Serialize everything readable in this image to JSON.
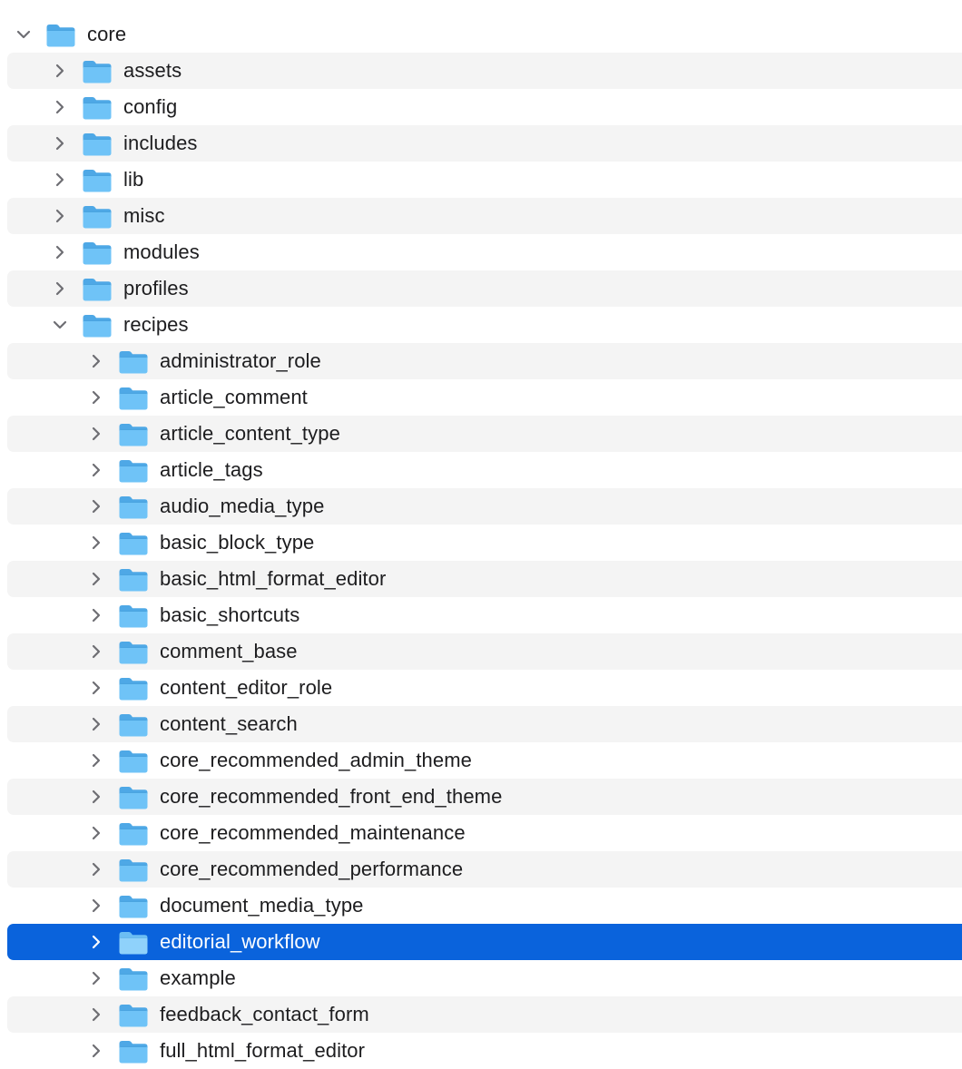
{
  "colors": {
    "selection": "#0a63dc",
    "stripe": "#f4f4f4",
    "folder_body": "#6fc3f7",
    "folder_tab": "#4ea8e6",
    "text": "#1d1d1f"
  },
  "tree": {
    "items": [
      {
        "label": "core",
        "depth": 0,
        "expanded": true,
        "icon": "folder-icon"
      },
      {
        "label": "assets",
        "depth": 1,
        "expanded": false,
        "icon": "folder-icon"
      },
      {
        "label": "config",
        "depth": 1,
        "expanded": false,
        "icon": "folder-icon"
      },
      {
        "label": "includes",
        "depth": 1,
        "expanded": false,
        "icon": "folder-icon"
      },
      {
        "label": "lib",
        "depth": 1,
        "expanded": false,
        "icon": "folder-icon"
      },
      {
        "label": "misc",
        "depth": 1,
        "expanded": false,
        "icon": "folder-icon"
      },
      {
        "label": "modules",
        "depth": 1,
        "expanded": false,
        "icon": "folder-icon"
      },
      {
        "label": "profiles",
        "depth": 1,
        "expanded": false,
        "icon": "folder-icon"
      },
      {
        "label": "recipes",
        "depth": 1,
        "expanded": true,
        "icon": "folder-icon"
      },
      {
        "label": "administrator_role",
        "depth": 2,
        "expanded": false,
        "icon": "folder-icon"
      },
      {
        "label": "article_comment",
        "depth": 2,
        "expanded": false,
        "icon": "folder-icon"
      },
      {
        "label": "article_content_type",
        "depth": 2,
        "expanded": false,
        "icon": "folder-icon"
      },
      {
        "label": "article_tags",
        "depth": 2,
        "expanded": false,
        "icon": "folder-icon"
      },
      {
        "label": "audio_media_type",
        "depth": 2,
        "expanded": false,
        "icon": "folder-icon"
      },
      {
        "label": "basic_block_type",
        "depth": 2,
        "expanded": false,
        "icon": "folder-icon"
      },
      {
        "label": "basic_html_format_editor",
        "depth": 2,
        "expanded": false,
        "icon": "folder-icon"
      },
      {
        "label": "basic_shortcuts",
        "depth": 2,
        "expanded": false,
        "icon": "folder-icon"
      },
      {
        "label": "comment_base",
        "depth": 2,
        "expanded": false,
        "icon": "folder-icon"
      },
      {
        "label": "content_editor_role",
        "depth": 2,
        "expanded": false,
        "icon": "folder-icon"
      },
      {
        "label": "content_search",
        "depth": 2,
        "expanded": false,
        "icon": "folder-icon"
      },
      {
        "label": "core_recommended_admin_theme",
        "depth": 2,
        "expanded": false,
        "icon": "folder-icon"
      },
      {
        "label": "core_recommended_front_end_theme",
        "depth": 2,
        "expanded": false,
        "icon": "folder-icon"
      },
      {
        "label": "core_recommended_maintenance",
        "depth": 2,
        "expanded": false,
        "icon": "folder-icon"
      },
      {
        "label": "core_recommended_performance",
        "depth": 2,
        "expanded": false,
        "icon": "folder-icon"
      },
      {
        "label": "document_media_type",
        "depth": 2,
        "expanded": false,
        "icon": "folder-icon"
      },
      {
        "label": "editorial_workflow",
        "depth": 2,
        "expanded": false,
        "selected": true,
        "icon": "folder-icon"
      },
      {
        "label": "example",
        "depth": 2,
        "expanded": false,
        "icon": "folder-icon"
      },
      {
        "label": "feedback_contact_form",
        "depth": 2,
        "expanded": false,
        "icon": "folder-icon"
      },
      {
        "label": "full_html_format_editor",
        "depth": 2,
        "expanded": false,
        "icon": "folder-icon"
      }
    ]
  }
}
